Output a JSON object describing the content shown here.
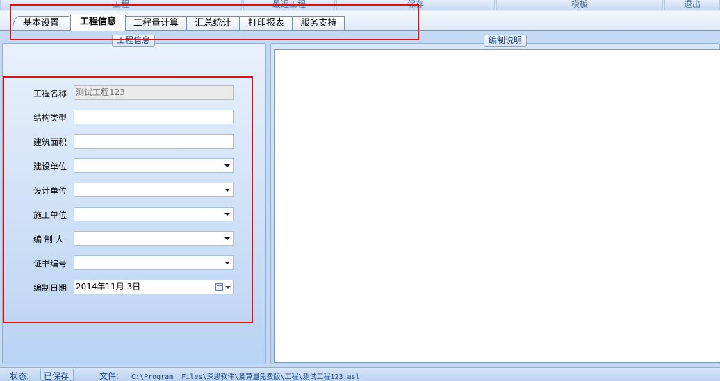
{
  "toolbar": {
    "project": "工程",
    "recent": "最近工程",
    "save": "保存",
    "template": "模板",
    "exit": "退出"
  },
  "tabs": [
    {
      "label": "基本设置"
    },
    {
      "label": "工程信息"
    },
    {
      "label": "工程量计算"
    },
    {
      "label": "汇总统计"
    },
    {
      "label": "打印报表"
    },
    {
      "label": "服务支持"
    }
  ],
  "active_tab": "工程信息",
  "left_panel": {
    "title": "工程信息",
    "fields": [
      {
        "label": "工程名称",
        "value": "测试工程123"
      },
      {
        "label": "结构类型",
        "value": ""
      },
      {
        "label": "建筑面积",
        "value": ""
      },
      {
        "label": "建设单位",
        "value": ""
      },
      {
        "label": "设计单位",
        "value": ""
      },
      {
        "label": "施工单位",
        "value": ""
      },
      {
        "label": "编 制 人",
        "value": ""
      },
      {
        "label": "证书编号",
        "value": ""
      },
      {
        "label": "编制日期",
        "value": "2014年11月  3日"
      }
    ]
  },
  "right_panel": {
    "title": "编制说明",
    "content": ""
  },
  "statusbar": {
    "status_label": "状态:",
    "status_value": "已保存",
    "file_label": "文件:",
    "file_path": "C:\\Program  Files\\深思软件\\爱算量免费版\\工程\\测试工程123.asl"
  },
  "colors": {
    "highlight_box": "#e01010",
    "accent": "#15428b"
  }
}
